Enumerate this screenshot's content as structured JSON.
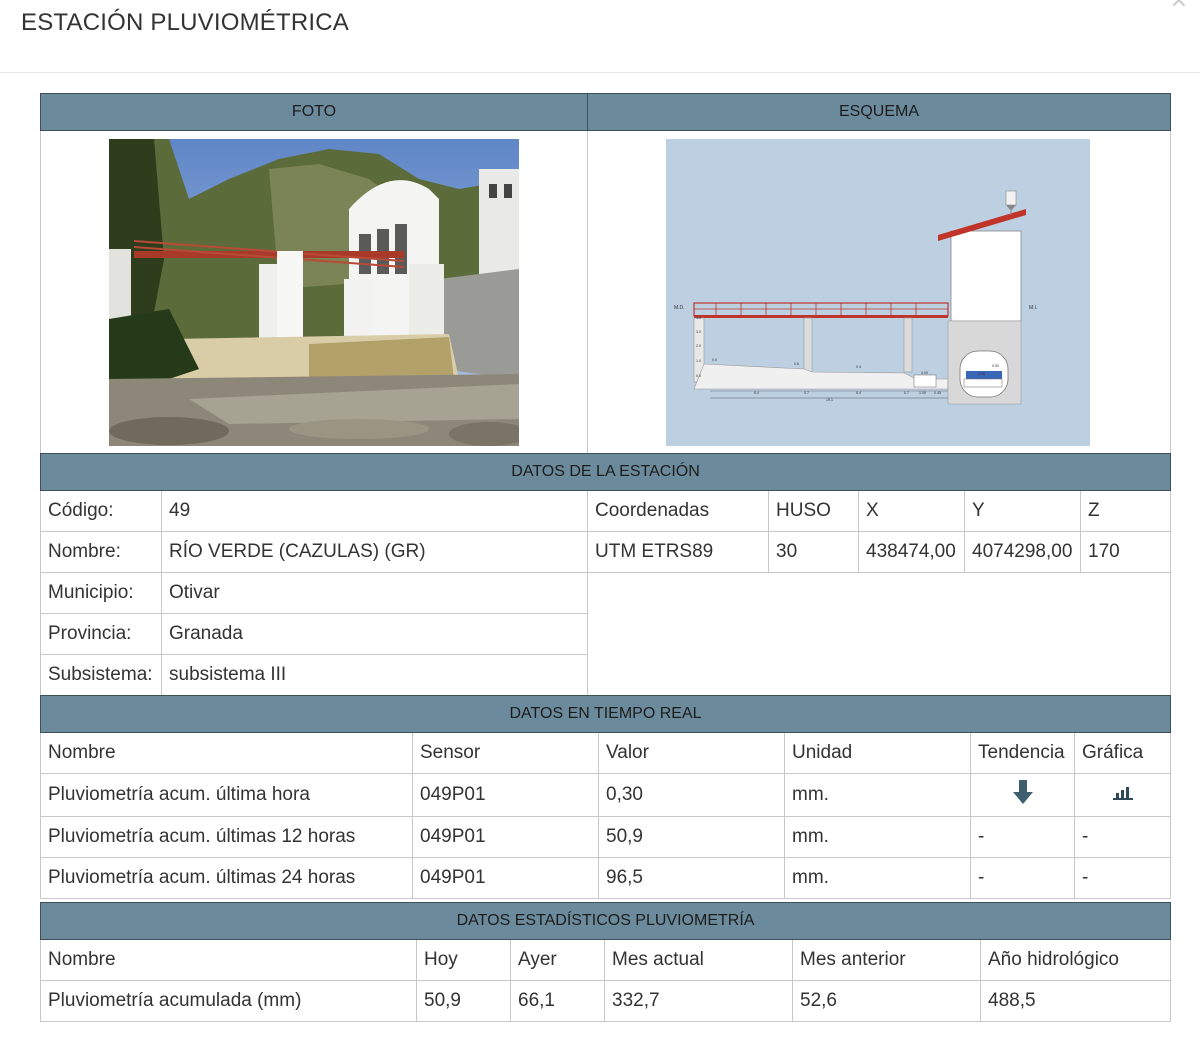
{
  "modal": {
    "title": "ESTACIÓN PLUVIOMÉTRICA",
    "close_icon": "×"
  },
  "headers": {
    "foto": "FOTO",
    "esquema": "ESQUEMA",
    "datos_estacion": "DATOS DE LA ESTACIÓN",
    "tiempo_real": "DATOS EN TIEMPO REAL",
    "estadisticos": "DATOS ESTADÍSTICOS PLUVIOMETRÍA"
  },
  "station": {
    "codigo_label": "Código:",
    "codigo": "49",
    "nombre_label": "Nombre:",
    "nombre": "RÍO VERDE (CAZULAS) (GR)",
    "municipio_label": "Municipio:",
    "municipio": "Otivar",
    "provincia_label": "Provincia:",
    "provincia": "Granada",
    "subsistema_label": "Subsistema:",
    "subsistema": "subsistema III"
  },
  "coords": {
    "headers": [
      "Coordenadas",
      "HUSO",
      "X",
      "Y",
      "Z"
    ],
    "values": [
      "UTM ETRS89",
      "30",
      "438474,00",
      "4074298,00",
      "170"
    ]
  },
  "realtime": {
    "columns": [
      "Nombre",
      "Sensor",
      "Valor",
      "Unidad",
      "Tendencia",
      "Gráfica"
    ],
    "rows": [
      {
        "nombre": "Pluviometría acum. última hora",
        "sensor": "049P01",
        "valor": "0,30",
        "unidad": "mm.",
        "tendencia": "arrow-down-icon",
        "grafica": "bar-chart-icon"
      },
      {
        "nombre": "Pluviometría acum. últimas 12 horas",
        "sensor": "049P01",
        "valor": "50,9",
        "unidad": "mm.",
        "tendencia": "-",
        "grafica": "-"
      },
      {
        "nombre": "Pluviometría acum. últimas 24 horas",
        "sensor": "049P01",
        "valor": "96,5",
        "unidad": "mm.",
        "tendencia": "-",
        "grafica": "-"
      }
    ]
  },
  "stats": {
    "columns": [
      "Nombre",
      "Hoy",
      "Ayer",
      "Mes actual",
      "Mes anterior",
      "Año hidrológico"
    ],
    "row": [
      "Pluviometría acumulada (mm)",
      "50,9",
      "66,1",
      "332,7",
      "52,6",
      "488,5"
    ]
  },
  "schema_labels": {
    "md": "M.D.",
    "mi": "M.I.",
    "levels": [
      "4.0",
      "3.0",
      "2.0",
      "1.0",
      "0.0"
    ],
    "dims": [
      "8.4",
      "0.7",
      "8.4",
      "0.7",
      "1.05",
      "0.45"
    ],
    "total": "19.1",
    "gauges": [
      "0.0",
      "0.6",
      "0.4",
      "0.50",
      "0.55",
      "0.00"
    ]
  },
  "colors": {
    "header_bg": "#6b8b9c",
    "header_border": "#3f4f58",
    "icon": "#3f5f70",
    "schema_bg": "#bcd0e2",
    "bridge": "#c0342a"
  }
}
